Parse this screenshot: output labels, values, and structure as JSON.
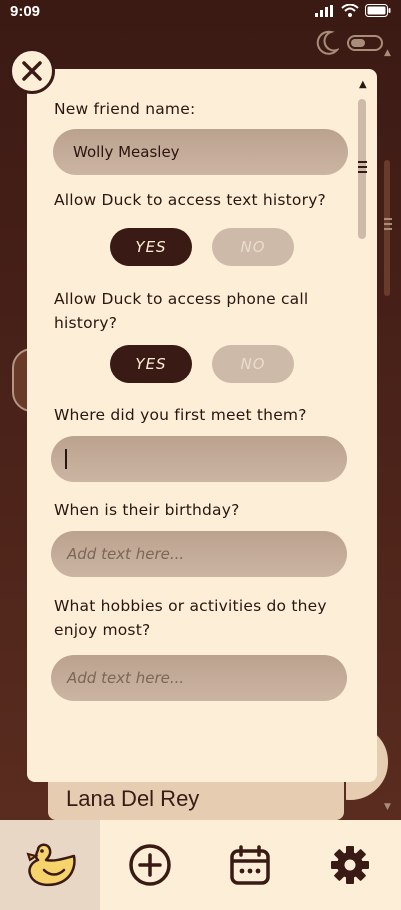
{
  "status_bar": {
    "time": "9:09"
  },
  "background": {
    "card_name": "Lana Del Rey"
  },
  "form": {
    "name_label": "New friend name:",
    "name_value": "Wolly Measley",
    "text_history_label": "Allow Duck to access text history?",
    "phone_history_label": "Allow Duck to access phone call history?",
    "yes_label": "YES",
    "no_label": "NO",
    "text_history_value": "YES",
    "phone_history_value": "YES",
    "meet_label": "Where did you first meet them?",
    "meet_value": "",
    "birthday_label": "When is their birthday?",
    "birthday_placeholder": "Add text here...",
    "hobbies_label": "What hobbies or activities do they enjoy most?",
    "hobbies_placeholder": "Add text here..."
  },
  "icons": {
    "close": "close-icon",
    "moon": "moon-icon",
    "tabs": [
      "duck-icon",
      "plus-circle-icon",
      "calendar-icon",
      "gear-icon"
    ]
  },
  "colors": {
    "background": "#3b1a14",
    "modal": "#fdefd7",
    "accent_dark": "#3a1a14",
    "input": "#bba28f",
    "pill_off": "#cdbaa9"
  }
}
